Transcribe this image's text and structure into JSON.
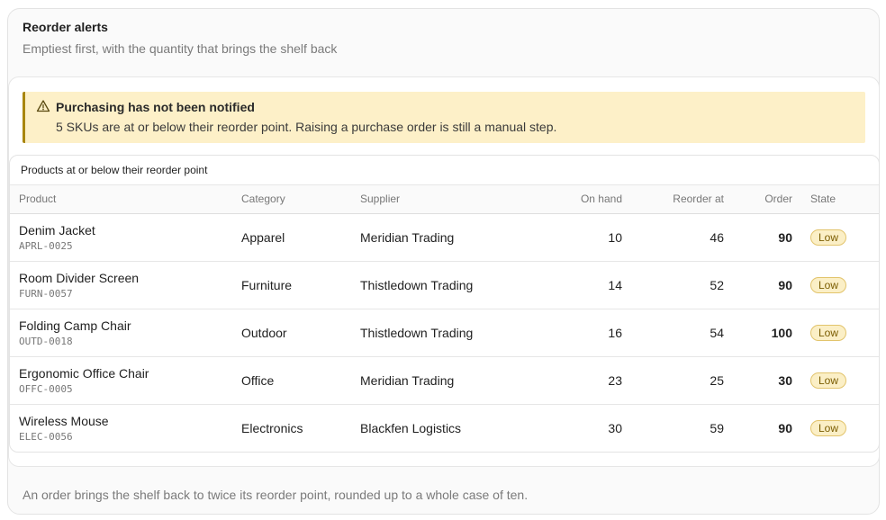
{
  "panel": {
    "title": "Reorder alerts",
    "subtitle": "Emptiest first, with the quantity that brings the shelf back"
  },
  "alert": {
    "icon": "warning-triangle-icon",
    "title": "Purchasing has not been notified",
    "body": "5 SKUs are at or below their reorder point. Raising a purchase order is still a manual step.",
    "accent": "#a8860f",
    "background": "#fdf0c8"
  },
  "table": {
    "caption": "Products at or below their reorder point",
    "headers": {
      "product": "Product",
      "category": "Category",
      "supplier": "Supplier",
      "on_hand": "On hand",
      "reorder_at": "Reorder at",
      "order": "Order",
      "state": "State"
    },
    "rows": [
      {
        "name": "Denim Jacket",
        "sku": "APRL-0025",
        "category": "Apparel",
        "supplier": "Meridian Trading",
        "on_hand": "10",
        "reorder_at": "46",
        "order": "90",
        "state": "Low"
      },
      {
        "name": "Room Divider Screen",
        "sku": "FURN-0057",
        "category": "Furniture",
        "supplier": "Thistledown Trading",
        "on_hand": "14",
        "reorder_at": "52",
        "order": "90",
        "state": "Low"
      },
      {
        "name": "Folding Camp Chair",
        "sku": "OUTD-0018",
        "category": "Outdoor",
        "supplier": "Thistledown Trading",
        "on_hand": "16",
        "reorder_at": "54",
        "order": "100",
        "state": "Low"
      },
      {
        "name": "Ergonomic Office Chair",
        "sku": "OFFC-0005",
        "category": "Office",
        "supplier": "Meridian Trading",
        "on_hand": "23",
        "reorder_at": "25",
        "order": "30",
        "state": "Low"
      },
      {
        "name": "Wireless Mouse",
        "sku": "ELEC-0056",
        "category": "Electronics",
        "supplier": "Blackfen Logistics",
        "on_hand": "30",
        "reorder_at": "59",
        "order": "90",
        "state": "Low"
      }
    ]
  },
  "footnote": "An order brings the shelf back to twice its reorder point, rounded up to a whole case of ten.",
  "colors": {
    "low_badge_bg": "#fbefc6",
    "low_badge_border": "#e2c46c",
    "low_badge_text": "#7a5c00"
  }
}
